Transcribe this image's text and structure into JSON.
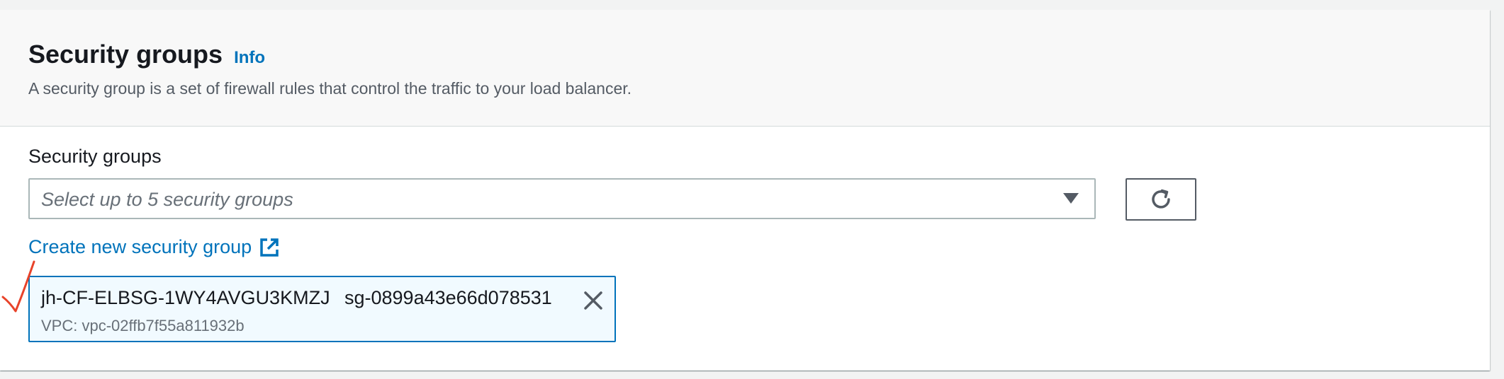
{
  "section": {
    "title": "Security groups",
    "info_label": "Info",
    "description": "A security group is a set of firewall rules that control the traffic to your load balancer."
  },
  "field": {
    "label": "Security groups",
    "placeholder": "Select up to 5 security groups",
    "refresh_icon": "refresh-icon",
    "dropdown_icon": "caret-down-icon"
  },
  "create_link": {
    "label": "Create new security group",
    "icon": "external-link-icon"
  },
  "selected_groups": [
    {
      "name": "jh-CF-ELBSG-1WY4AVGU3KMZJ",
      "id": "sg-0899a43e66d078531",
      "vpc": "VPC: vpc-02ffb7f55a811932b",
      "remove_icon": "close-icon"
    }
  ],
  "colors": {
    "link": "#0073bb",
    "token_border": "#0073bb",
    "token_bg": "#f1faff",
    "annotation": "#e8432a"
  }
}
